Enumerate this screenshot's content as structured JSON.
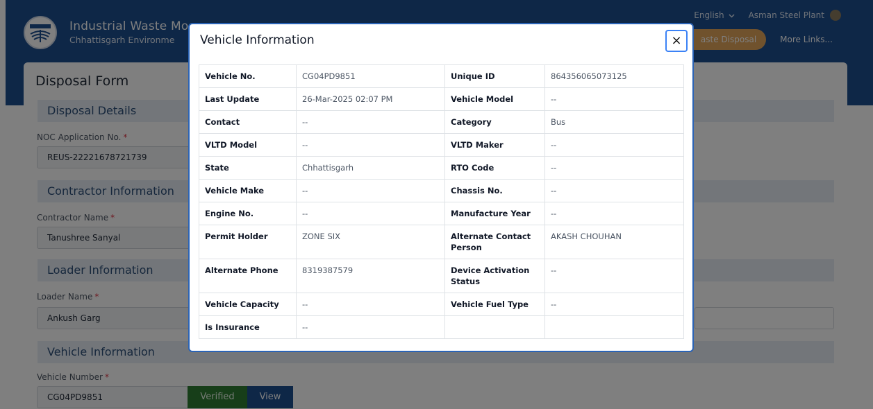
{
  "header": {
    "title": "Industrial Waste Mo",
    "subtitle": "Chhattisgarh Environme",
    "language": "English",
    "user": "Asman Steel Plant",
    "nav_active": "aste Disposal",
    "nav_more": "More Links..."
  },
  "form": {
    "title": "Disposal Form",
    "sections": {
      "disposal": "Disposal Details",
      "contractor": "Contractor Information",
      "loader": "Loader Information",
      "vehicle": "Vehicle Information"
    },
    "fields": {
      "noc_label": "NOC Application No.",
      "noc_value": "REUS-22221678721739",
      "contractor_label": "Contractor Name",
      "contractor_value": "Tanushree Sanyal",
      "loader_label": "Loader Name",
      "loader_value": "Ankush Garg",
      "vehicle_label": "Vehicle Number",
      "vehicle_value": "CG04PD9851"
    },
    "required_mark": "*",
    "verified_label": "Verified",
    "view_label": "View"
  },
  "modal": {
    "title": "Vehicle Information",
    "close": "×",
    "rows": [
      [
        "Vehicle No.",
        "CG04PD9851",
        "Unique ID",
        "864356065073125"
      ],
      [
        "Last Update",
        "26-Mar-2025 02:07 PM",
        "Vehicle Model",
        "--"
      ],
      [
        "Contact",
        "--",
        "Category",
        "Bus"
      ],
      [
        "VLTD Model",
        "--",
        "VLTD Maker",
        "--"
      ],
      [
        "State",
        "Chhattisgarh",
        "RTO Code",
        "--"
      ],
      [
        "Vehicle Make",
        "--",
        "Chassis No.",
        "--"
      ],
      [
        "Engine No.",
        "--",
        "Manufacture Year",
        "--"
      ],
      [
        "Permit Holder",
        "ZONE SIX",
        "Alternate Contact Person",
        "AKASH CHOUHAN"
      ],
      [
        "Alternate Phone",
        "8319387579",
        "Device Activation Status",
        "--"
      ],
      [
        "Vehicle Capacity",
        "--",
        "Vehicle Fuel Type",
        "--"
      ],
      [
        "Is Insurance",
        "--",
        "",
        ""
      ]
    ]
  }
}
